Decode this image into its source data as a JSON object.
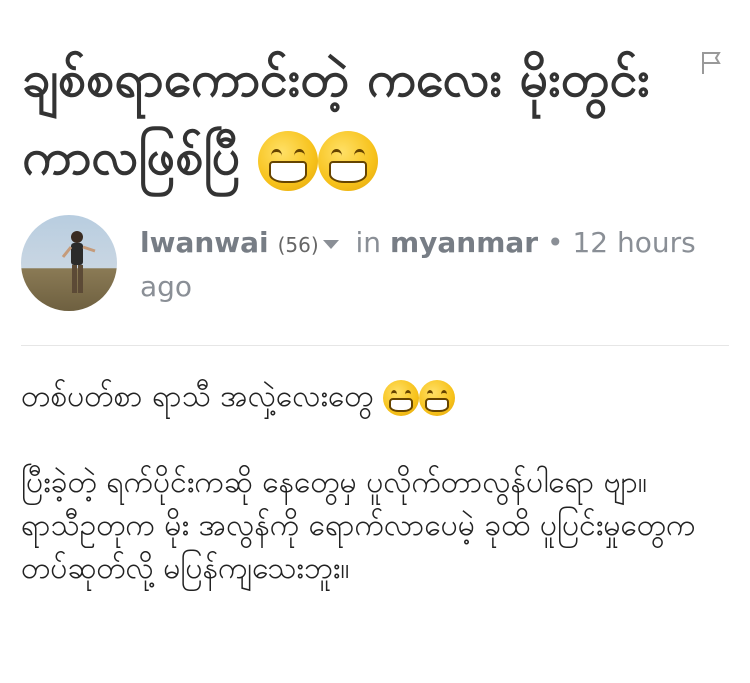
{
  "post": {
    "title": "ချစ်စရာကောင်းတဲ့ ကလေး မိုးတွင်းကာလဖြစ်ပြီ",
    "title_emoji": [
      "grinning-face-with-smiling-eyes-icon",
      "grinning-face-with-smiling-eyes-icon"
    ]
  },
  "author": {
    "name": "lwanwai",
    "reputation": "(56)",
    "in_label": "in",
    "community": "myanmar",
    "separator": "•",
    "time": "12 hours ago"
  },
  "body": {
    "line1": "တစ်ပတ်စာ ရာသီ အလှဲ့လေးတွေ",
    "line2": "ပြီးခဲ့တဲ့ ရက်ပိုင်းကဆို နေတွေမှ ပူလိုက်တာလွန်ပါရော ဗျာ။",
    "line3": "ရာသီဥတုက မိုး အလွန်ကို ရောက်လာပေမဲ့ ခုထိ ပူပြင်းမှုတွေက တပ်ဆုတ်လို့ မပြန်ကျသေးဘူး။"
  },
  "colors": {
    "title": "#333333",
    "meta": "#8a8f96",
    "emoji": "#f7c21b"
  }
}
